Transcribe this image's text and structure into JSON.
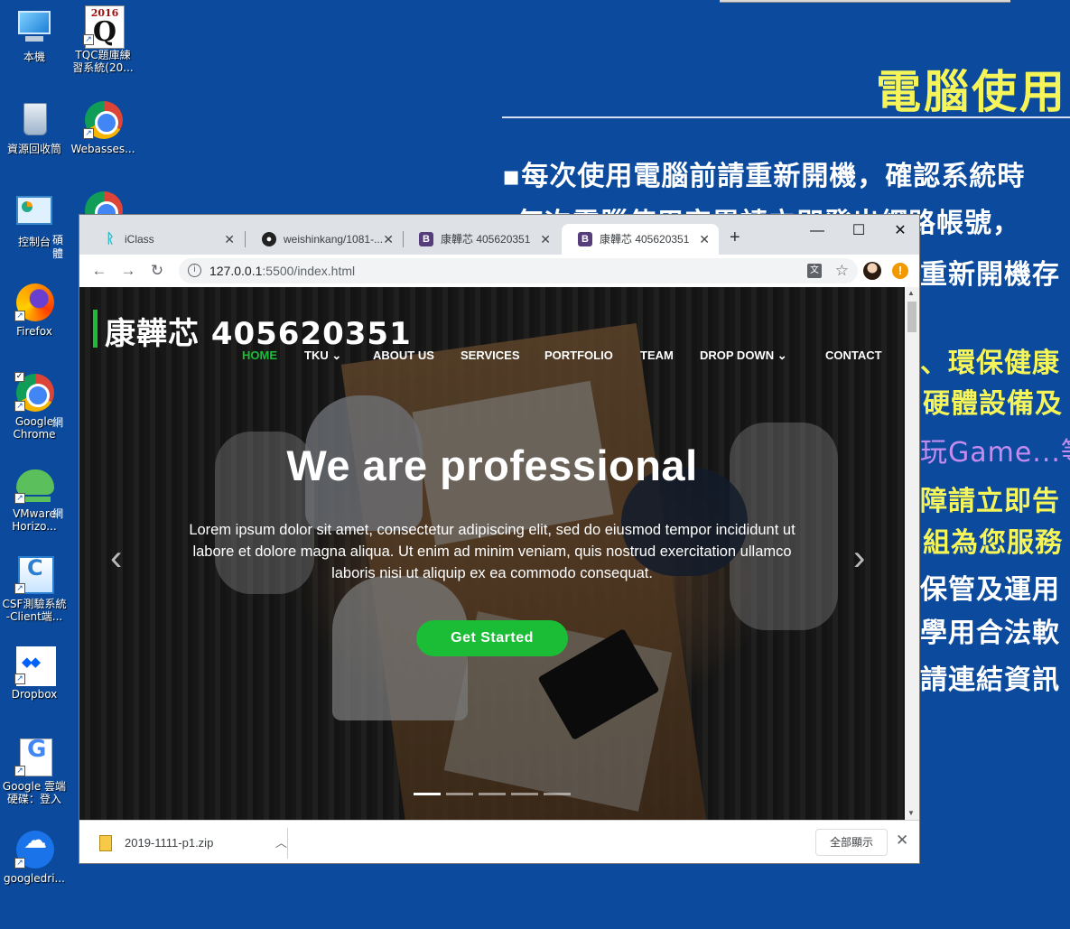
{
  "desktop": {
    "icons": [
      {
        "label": "本機"
      },
      {
        "label": "TQC題庫練\n習系統(20...",
        "year": "2016",
        "letter": "Q"
      },
      {
        "label": "資源回收筒"
      },
      {
        "label": "Webasses..."
      },
      {
        "label": "控制台"
      },
      {
        "label": "Firefox"
      },
      {
        "label": "Google\nChrome"
      },
      {
        "label": "VMware\nHorizo..."
      },
      {
        "label": "CSF測驗系統\n-Client端..."
      },
      {
        "label": "Dropbox"
      },
      {
        "label": "Google 雲端\n硬碟：登入"
      },
      {
        "label": "googledri..."
      }
    ],
    "partial_icon_labels": [
      "碩",
      "體",
      "網",
      "網"
    ],
    "slide": {
      "title": "電腦使用",
      "lines": [
        "▪每次使用電腦前請重新開機，確認系統時",
        "每次電腦使用完畢請立即登出網路帳號，",
        "重新開機存",
        "、環保健康",
        "硬體設備及",
        "玩Game...等",
        "障請立即告",
        "組為您服務",
        "保管及運用",
        "學用合法軟",
        "請連結資訊"
      ]
    }
  },
  "browser": {
    "tabs": [
      {
        "title": "iClass"
      },
      {
        "title": "weishinkang/1081-..."
      },
      {
        "title": "康韡芯 405620351"
      },
      {
        "title": "康韡芯 405620351"
      }
    ],
    "new_tab": "+",
    "window_controls": {
      "minimize": "—",
      "maximize": "☐",
      "close": "✕"
    },
    "url_host": "127.0.0.1",
    "url_rest": ":5500/index.html",
    "translate_glyph": "文",
    "alert_glyph": "!"
  },
  "page": {
    "brand": "康韡芯  405620351",
    "menu": [
      "HOME",
      "TKU ⌄",
      "ABOUT US",
      "SERVICES",
      "PORTFOLIO",
      "TEAM",
      "DROP DOWN ⌄",
      "CONTACT"
    ],
    "hero_title": "We are professional",
    "hero_text": "Lorem ipsum dolor sit amet, consectetur adipiscing elit, sed do eiusmod tempor incididunt ut labore et dolore magna aliqua. Ut enim ad minim veniam, quis nostrud exercitation ullamco laboris nisi ut aliquip ex ea commodo consequat.",
    "cta": "Get Started",
    "prev_arrow": "‹",
    "next_arrow": "›",
    "slide_count": 5,
    "active_slide": 1,
    "accent_color": "#1bbd36"
  },
  "downloads": {
    "file": "2019-1111-p1.zip",
    "show_all": "全部顯示",
    "close": "✕"
  }
}
